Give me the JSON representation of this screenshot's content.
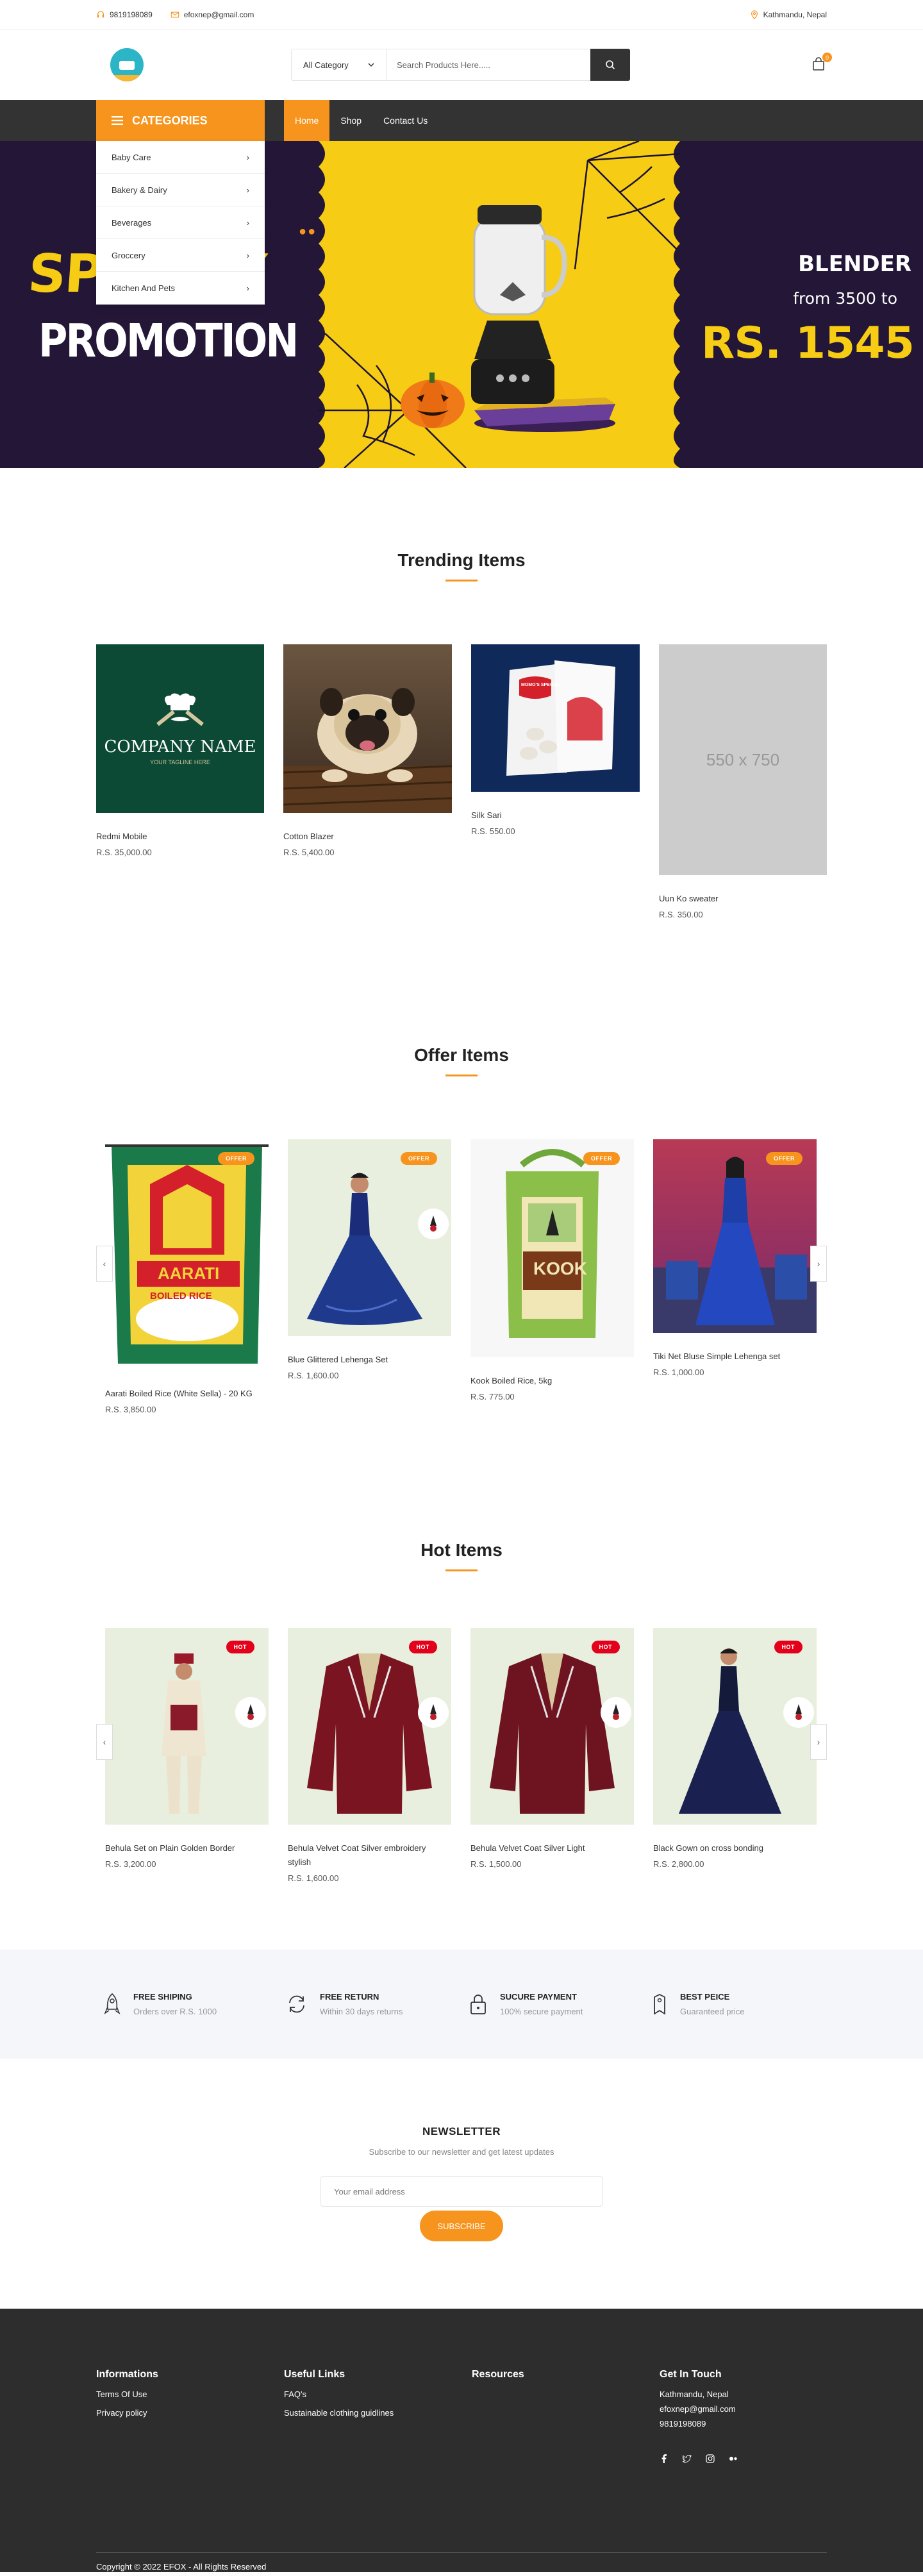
{
  "topbar": {
    "phone": "9819198089",
    "email": "efoxnep@gmail.com",
    "location": "Kathmandu, Nepal"
  },
  "header": {
    "category_select": "All Category",
    "search_placeholder": "Search Products Here.....",
    "cart_count": "0"
  },
  "nav": {
    "categories_label": "CATEGORIES",
    "links": [
      {
        "label": "Home",
        "active": true
      },
      {
        "label": "Shop",
        "active": false
      },
      {
        "label": "Contact Us",
        "active": false
      }
    ]
  },
  "category_menu": [
    "Baby Care",
    "Bakery & Dairy",
    "Beverages",
    "Groccery",
    "Kitchen And Pets"
  ],
  "hero": {
    "headline_1": "SPOOKY",
    "headline_2": "PROMOTION",
    "product": "BLENDER",
    "from_text": "from 3500 to",
    "price": "RS. 1545"
  },
  "trending": {
    "title": "Trending Items",
    "items": [
      {
        "name": "Redmi Mobile",
        "price": "R.S. 35,000.00",
        "logo_text": "COMPANY NAME",
        "logo_tagline": "YOUR TAGLINE HERE"
      },
      {
        "name": "Cotton Blazer",
        "price": "R.S. 5,400.00"
      },
      {
        "name": "Silk Sari",
        "price": "R.S. 550.00",
        "pack_label": "MOMO'S SPECIAL"
      },
      {
        "name": "Uun Ko sweater",
        "price": "R.S. 350.00",
        "placeholder": "550 x 750"
      }
    ]
  },
  "offers": {
    "title": "Offer Items",
    "badge": "OFFER",
    "items": [
      {
        "name": "Aarati Boiled Rice (White Sella) - 20 KG",
        "price": "R.S. 3,850.00",
        "bag_brand": "AARATI",
        "bag_type": "BOILED RICE"
      },
      {
        "name": "Blue Glittered Lehenga Set",
        "price": "R.S. 1,600.00"
      },
      {
        "name": "Kook Boiled Rice, 5kg",
        "price": "R.S. 775.00",
        "bag_brand": "KOOK"
      },
      {
        "name": "Tiki Net Bluse Simple Lehenga set",
        "price": "R.S. 1,000.00"
      }
    ]
  },
  "hot": {
    "title": "Hot Items",
    "badge": "HOT",
    "items": [
      {
        "name": "Behula Set on Plain Golden Border",
        "price": "R.S. 3,200.00"
      },
      {
        "name": "Behula Velvet Coat Silver embroidery stylish",
        "price": "R.S. 1,600.00"
      },
      {
        "name": "Behula Velvet Coat Silver Light",
        "price": "R.S. 1,500.00"
      },
      {
        "name": "Black Gown on cross bonding",
        "price": "R.S. 2,800.00"
      }
    ]
  },
  "features": [
    {
      "title": "FREE SHIPING",
      "sub": "Orders over R.S. 1000",
      "icon": "rocket-icon"
    },
    {
      "title": "FREE RETURN",
      "sub": "Within 30 days returns",
      "icon": "refresh-icon"
    },
    {
      "title": "SUCURE PAYMENT",
      "sub": "100% secure payment",
      "icon": "lock-icon"
    },
    {
      "title": "BEST PEICE",
      "sub": "Guaranteed price",
      "icon": "tag-icon"
    }
  ],
  "newsletter": {
    "title": "NEWSLETTER",
    "subtitle": "Subscribe to our newsletter and get latest updates",
    "placeholder": "Your email address",
    "button": "SUBSCRIBE"
  },
  "footer": {
    "informations": {
      "title": "Informations",
      "links": [
        "Terms Of Use",
        "Privacy policy"
      ]
    },
    "useful": {
      "title": "Useful Links",
      "links": [
        "FAQ's",
        "Sustainable clothing guidlines"
      ]
    },
    "resources": {
      "title": "Resources"
    },
    "contact": {
      "title": "Get In Touch",
      "address": "Kathmandu, Nepal",
      "email": "efoxnep@gmail.com",
      "phone": "9819198089"
    },
    "copyright": "Copyright © 2022 EFOX - All Rights Reserved"
  },
  "colors": {
    "accent": "#f7941d",
    "dark": "#333333",
    "hot": "#e3001b"
  }
}
